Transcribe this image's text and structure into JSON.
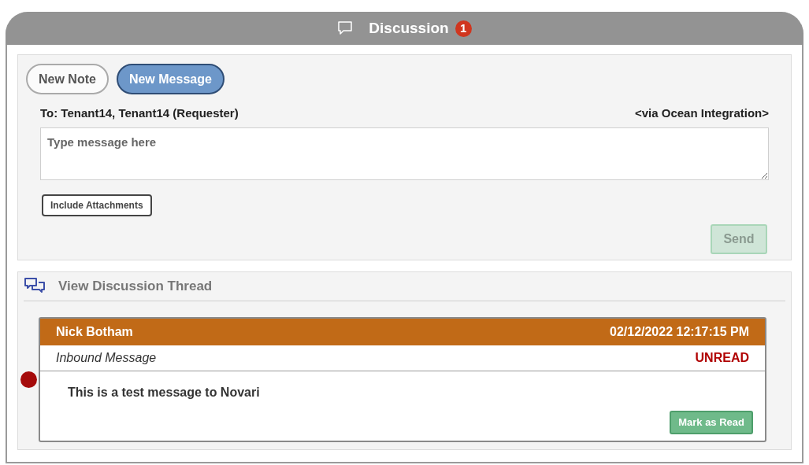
{
  "header": {
    "title": "Discussion",
    "badge": "1"
  },
  "tabs": [
    {
      "label": "New Note",
      "selected": false
    },
    {
      "label": "New Message",
      "selected": true
    }
  ],
  "compose": {
    "to": "To: Tenant14, Tenant14 (Requester)",
    "via": "<via Ocean Integration>",
    "placeholder": "Type message here",
    "attachments_button": "Include Attachments",
    "send_button": {
      "label": "Send",
      "disabled": true
    }
  },
  "thread": {
    "title": "View Discussion Thread",
    "messages": [
      {
        "sender": "Nick Botham",
        "timestamp": "02/12/2022 12:17:15 PM",
        "type": "Inbound Message",
        "status": "UNREAD",
        "unread": true,
        "body": "This is a test message to Novari",
        "action": "Mark as Read"
      }
    ]
  }
}
